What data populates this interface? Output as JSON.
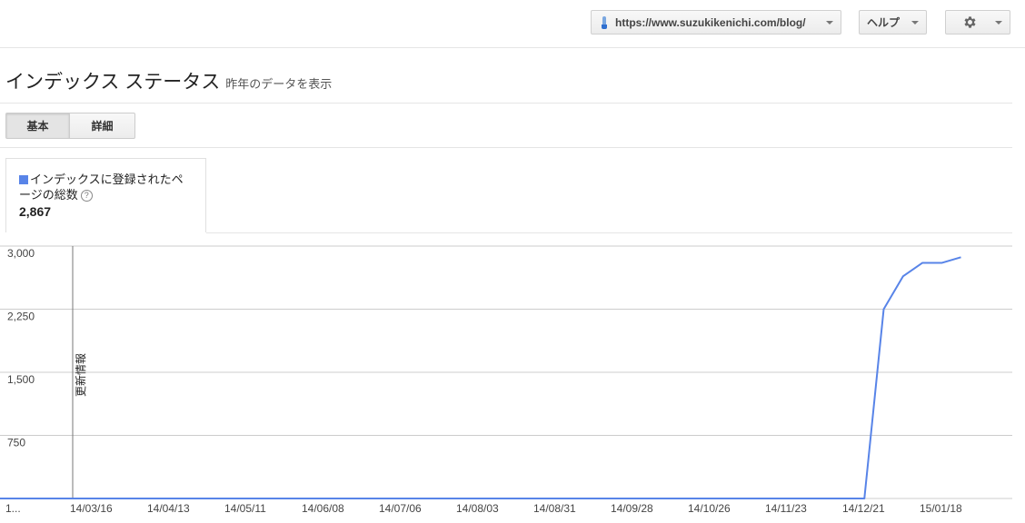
{
  "topbar": {
    "site_url": "https://www.suzukikenichi.com/blog/",
    "help_label": "ヘルプ"
  },
  "page": {
    "title": "インデックス ステータス",
    "subtitle": "昨年のデータを表示"
  },
  "view_tabs": [
    {
      "label": "基本",
      "active": true
    },
    {
      "label": "詳細",
      "active": false
    }
  ],
  "legend": {
    "label": "インデックスに登録されたページの総数",
    "value": "2,867",
    "color": "#5884e8"
  },
  "icons": [
    "site-favicon-icon",
    "chevron-down-icon",
    "gear-icon",
    "help-icon"
  ],
  "chart_data": {
    "type": "line",
    "title": "",
    "xlabel": "",
    "ylabel": "",
    "ylim": [
      0,
      3000
    ],
    "y_ticks": [
      "750",
      "1,500",
      "2,250",
      "3,000"
    ],
    "x_tick_labels": [
      "1...",
      "14/03/16",
      "14/04/13",
      "14/05/11",
      "14/06/08",
      "14/07/06",
      "14/08/03",
      "14/08/31",
      "14/09/28",
      "14/10/26",
      "14/11/23",
      "14/12/21",
      "15/01/18"
    ],
    "annotation": {
      "label": "更新情報",
      "x": "14/03/16"
    },
    "series": [
      {
        "name": "インデックスに登録されたページの総数",
        "color": "#5884e8",
        "x": [
          "14/02/16",
          "14/03/16",
          "14/04/13",
          "14/05/11",
          "14/06/08",
          "14/07/06",
          "14/08/03",
          "14/08/31",
          "14/09/28",
          "14/10/26",
          "14/11/23",
          "14/12/21",
          "14/12/28",
          "15/01/04",
          "15/01/11",
          "15/01/18",
          "15/01/25",
          "15/02/01"
        ],
        "values": [
          0,
          0,
          0,
          0,
          0,
          0,
          0,
          0,
          0,
          0,
          0,
          0,
          0,
          2250,
          2640,
          2800,
          2800,
          2867
        ]
      }
    ]
  }
}
